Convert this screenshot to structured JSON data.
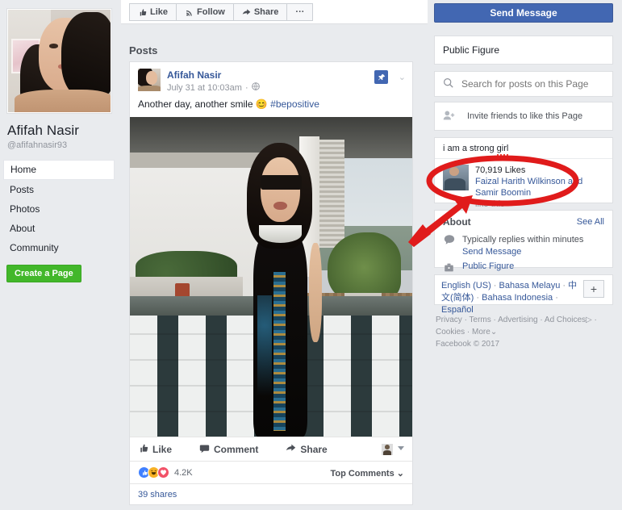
{
  "left": {
    "page_name": "Afifah Nasir",
    "handle": "@afifahnasir93",
    "nav": [
      {
        "label": "Home",
        "active": true
      },
      {
        "label": "Posts",
        "active": false
      },
      {
        "label": "Photos",
        "active": false
      },
      {
        "label": "About",
        "active": false
      },
      {
        "label": "Community",
        "active": false
      }
    ],
    "create_page": "Create a Page"
  },
  "action_bar": {
    "like": "Like",
    "follow": "Follow",
    "share": "Share",
    "more": "···"
  },
  "center": {
    "posts_label": "Posts",
    "post": {
      "author": "Afifah Nasir",
      "timestamp": "July 31 at 10:03am",
      "privacy_icon": "globe-icon",
      "pin_icon": "pin-icon",
      "text_before": "Another day, another smile ",
      "emoji": "😊",
      "hashtag": "#bepositive",
      "actions": {
        "like": "Like",
        "comment": "Comment",
        "share": "Share"
      },
      "reaction_count": "4.2K",
      "reactions": [
        "like",
        "haha",
        "love"
      ],
      "top_comments": "Top Comments",
      "shares": "39 shares"
    }
  },
  "right": {
    "send_message": "Send Message",
    "category": "Public Figure",
    "search_placeholder": "Search for posts on this Page",
    "invite": "Invite friends to like this Page",
    "likes_card": {
      "title_a": "i am a strong ",
      "title_b": "girl",
      "count": "70,919 Likes",
      "friends": "Faizal Harith Wilkinson and Samir Boomin",
      "like_this": "like this"
    },
    "about": {
      "title": "About",
      "see_all": "See All",
      "reply_time": "Typically replies within minutes",
      "send_message": "Send Message",
      "category": "Public Figure"
    },
    "languages": [
      "English (US)",
      "Bahasa Melayu",
      "中文(简体)",
      "Bahasa Indonesia",
      "Español"
    ],
    "lang_more": "+",
    "footer": {
      "line1": [
        "Privacy",
        "Terms",
        "Advertising",
        "Ad Choices"
      ],
      "line2": [
        "Cookies",
        "More"
      ],
      "copyright": "Facebook © 2017"
    }
  },
  "annotation": {
    "circle_color": "#e01b1b",
    "arrow_color": "#e01b1b"
  }
}
